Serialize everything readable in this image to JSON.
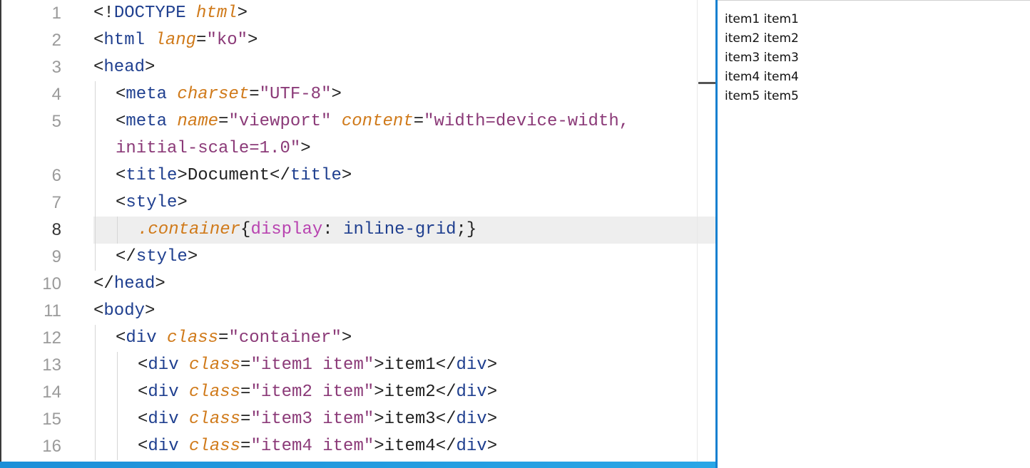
{
  "editor": {
    "lines": [
      {
        "num": "1",
        "tokens": [
          [
            "t-punct",
            "<!"
          ],
          [
            "t-tag",
            "DOCTYPE "
          ],
          [
            "t-attr",
            "html"
          ],
          [
            "t-punct",
            ">"
          ]
        ]
      },
      {
        "num": "2",
        "tokens": [
          [
            "t-punct",
            "<"
          ],
          [
            "t-tag",
            "html "
          ],
          [
            "t-attr",
            "lang"
          ],
          [
            "t-punct",
            "="
          ],
          [
            "t-str",
            "\"ko\""
          ],
          [
            "t-punct",
            ">"
          ]
        ]
      },
      {
        "num": "3",
        "tokens": [
          [
            "t-punct",
            "<"
          ],
          [
            "t-tag",
            "head"
          ],
          [
            "t-punct",
            ">"
          ]
        ]
      },
      {
        "num": "4",
        "tokens": [
          [
            "t-punct",
            "<"
          ],
          [
            "t-tag",
            "meta "
          ],
          [
            "t-attr",
            "charset"
          ],
          [
            "t-punct",
            "="
          ],
          [
            "t-str",
            "\"UTF-8\""
          ],
          [
            "t-punct",
            ">"
          ]
        ]
      },
      {
        "num": "5",
        "tokens": [
          [
            "t-punct",
            "<"
          ],
          [
            "t-tag",
            "meta "
          ],
          [
            "t-attr",
            "name"
          ],
          [
            "t-punct",
            "="
          ],
          [
            "t-str",
            "\"viewport\" "
          ],
          [
            "t-attr",
            "content"
          ],
          [
            "t-punct",
            "="
          ],
          [
            "t-str",
            "\"width=device-width,"
          ]
        ]
      },
      {
        "num": "",
        "tokens": [
          [
            "t-str",
            "initial-scale=1.0\""
          ],
          [
            "t-punct",
            ">"
          ]
        ]
      },
      {
        "num": "6",
        "tokens": [
          [
            "t-punct",
            "<"
          ],
          [
            "t-tag",
            "title"
          ],
          [
            "t-punct",
            ">"
          ],
          [
            "t-text",
            "Document"
          ],
          [
            "t-punct",
            "</"
          ],
          [
            "t-tag",
            "title"
          ],
          [
            "t-punct",
            ">"
          ]
        ]
      },
      {
        "num": "7",
        "tokens": [
          [
            "t-punct",
            "<"
          ],
          [
            "t-tag",
            "style"
          ],
          [
            "t-punct",
            ">"
          ]
        ]
      },
      {
        "num": "8",
        "tokens": [
          [
            "t-sel",
            ".container"
          ],
          [
            "t-punct",
            "{"
          ],
          [
            "t-prop",
            "display"
          ],
          [
            "t-punct",
            ": "
          ],
          [
            "t-val",
            "inline-grid"
          ],
          [
            "t-punct",
            ";}"
          ]
        ]
      },
      {
        "num": "9",
        "tokens": [
          [
            "t-punct",
            "</"
          ],
          [
            "t-tag",
            "style"
          ],
          [
            "t-punct",
            ">"
          ]
        ]
      },
      {
        "num": "10",
        "tokens": [
          [
            "t-punct",
            "</"
          ],
          [
            "t-tag",
            "head"
          ],
          [
            "t-punct",
            ">"
          ]
        ]
      },
      {
        "num": "11",
        "tokens": [
          [
            "t-punct",
            "<"
          ],
          [
            "t-tag",
            "body"
          ],
          [
            "t-punct",
            ">"
          ]
        ]
      },
      {
        "num": "12",
        "tokens": [
          [
            "t-punct",
            "<"
          ],
          [
            "t-tag",
            "div "
          ],
          [
            "t-attr",
            "class"
          ],
          [
            "t-punct",
            "="
          ],
          [
            "t-str",
            "\"container\""
          ],
          [
            "t-punct",
            ">"
          ]
        ]
      },
      {
        "num": "13",
        "tokens": [
          [
            "t-punct",
            "<"
          ],
          [
            "t-tag",
            "div "
          ],
          [
            "t-attr",
            "class"
          ],
          [
            "t-punct",
            "="
          ],
          [
            "t-str",
            "\"item1 item\""
          ],
          [
            "t-punct",
            ">"
          ],
          [
            "t-text",
            "item1"
          ],
          [
            "t-punct",
            "</"
          ],
          [
            "t-tag",
            "div"
          ],
          [
            "t-punct",
            ">"
          ]
        ]
      },
      {
        "num": "14",
        "tokens": [
          [
            "t-punct",
            "<"
          ],
          [
            "t-tag",
            "div "
          ],
          [
            "t-attr",
            "class"
          ],
          [
            "t-punct",
            "="
          ],
          [
            "t-str",
            "\"item2 item\""
          ],
          [
            "t-punct",
            ">"
          ],
          [
            "t-text",
            "item2"
          ],
          [
            "t-punct",
            "</"
          ],
          [
            "t-tag",
            "div"
          ],
          [
            "t-punct",
            ">"
          ]
        ]
      },
      {
        "num": "15",
        "tokens": [
          [
            "t-punct",
            "<"
          ],
          [
            "t-tag",
            "div "
          ],
          [
            "t-attr",
            "class"
          ],
          [
            "t-punct",
            "="
          ],
          [
            "t-str",
            "\"item3 item\""
          ],
          [
            "t-punct",
            ">"
          ],
          [
            "t-text",
            "item3"
          ],
          [
            "t-punct",
            "</"
          ],
          [
            "t-tag",
            "div"
          ],
          [
            "t-punct",
            ">"
          ]
        ]
      },
      {
        "num": "16",
        "tokens": [
          [
            "t-punct",
            "<"
          ],
          [
            "t-tag",
            "div "
          ],
          [
            "t-attr",
            "class"
          ],
          [
            "t-punct",
            "="
          ],
          [
            "t-str",
            "\"item4 item\""
          ],
          [
            "t-punct",
            ">"
          ],
          [
            "t-text",
            "item4"
          ],
          [
            "t-punct",
            "</"
          ],
          [
            "t-tag",
            "div"
          ],
          [
            "t-punct",
            ">"
          ]
        ]
      }
    ],
    "current_line": "8"
  },
  "preview": {
    "items": [
      {
        "a": "item1",
        "b": "item1"
      },
      {
        "a": "item2",
        "b": "item2"
      },
      {
        "a": "item3",
        "b": "item3"
      },
      {
        "a": "item4",
        "b": "item4"
      },
      {
        "a": "item5",
        "b": "item5"
      }
    ]
  },
  "colors": {
    "accent": "#1580d0",
    "tag": "#1f3f8f",
    "attribute": "#d07a1a",
    "string": "#8b3a78",
    "property": "#b843b0"
  }
}
